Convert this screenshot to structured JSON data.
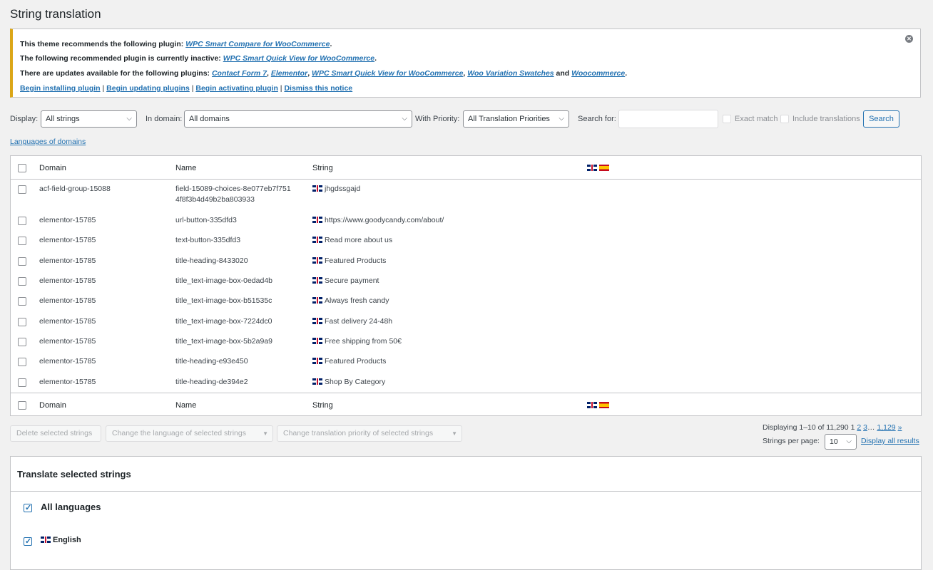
{
  "page": {
    "title": "String translation"
  },
  "notice": {
    "line1_prefix": "This theme recommends the following plugin: ",
    "line1_link": "WPC Smart Compare for WooCommerce",
    "line2_prefix": "The following recommended plugin is currently inactive: ",
    "line2_link": "WPC Smart Quick View for WooCommerce",
    "line3_prefix": "There are updates available for the following plugins: ",
    "line3_links": [
      "Contact Form 7",
      "Elementor",
      "WPC Smart Quick View for WooCommerce",
      "Woo Variation Swatches",
      "Woocommerce"
    ],
    "line3_and": " and ",
    "actions": [
      "Begin installing plugin",
      "Begin updating plugins",
      "Begin activating plugin",
      "Dismiss this notice"
    ],
    "separator": " | "
  },
  "filters": {
    "display_label": "Display:",
    "display_value": "All strings",
    "domain_label": "In domain:",
    "domain_value": "All domains",
    "priority_label": "With Priority:",
    "priority_value": "All Translation Priorities",
    "search_label": "Search for:",
    "search_value": "",
    "exact_match_label": "Exact match",
    "include_translations_label": "Include translations",
    "search_button": "Search"
  },
  "languages_of_domains_link": "Languages of domains",
  "table": {
    "headers": {
      "domain": "Domain",
      "name": "Name",
      "string": "String"
    },
    "rows": [
      {
        "domain": "acf-field-group-15088",
        "name": "field-15089-choices-8e077eb7f751",
        "name2": "4f8f3b4d49b2ba803933",
        "string": "jhgdssgajd"
      },
      {
        "domain": "elementor-15785",
        "name": "url-button-335dfd3",
        "string": "https://www.goodycandy.com/about/"
      },
      {
        "domain": "elementor-15785",
        "name": "text-button-335dfd3",
        "string": "Read more about us"
      },
      {
        "domain": "elementor-15785",
        "name": "title-heading-8433020",
        "string": "Featured Products"
      },
      {
        "domain": "elementor-15785",
        "name": "title_text-image-box-0edad4b",
        "string": "Secure payment"
      },
      {
        "domain": "elementor-15785",
        "name": "title_text-image-box-b51535c",
        "string": "Always fresh candy"
      },
      {
        "domain": "elementor-15785",
        "name": "title_text-image-box-7224dc0",
        "string": "Fast delivery 24-48h"
      },
      {
        "domain": "elementor-15785",
        "name": "title_text-image-box-5b2a9a9",
        "string": "Free shipping from 50€"
      },
      {
        "domain": "elementor-15785",
        "name": "title-heading-e93e450",
        "string": "Featured Products"
      },
      {
        "domain": "elementor-15785",
        "name": "title-heading-de394e2",
        "string": "Shop By Category"
      }
    ]
  },
  "bulk": {
    "delete": "Delete selected strings",
    "change_language": "Change the language of selected strings",
    "change_priority": "Change translation priority of selected strings"
  },
  "pagination": {
    "displaying": "Displaying 1–10 of 11,290",
    "current": "1",
    "pages": [
      "2",
      "3"
    ],
    "ellipsis": "…",
    "last": "1,129",
    "next": "»",
    "per_page_label": "Strings per page:",
    "per_page_value": "10",
    "display_all": "Display all results"
  },
  "translate_panel": {
    "title": "Translate selected strings",
    "all_languages": "All languages",
    "english": "English"
  },
  "flags": {
    "uk": "uk-flag-icon",
    "es": "es-flag-icon"
  },
  "colors": {
    "link": "#2271b1",
    "notice_border": "#dba617"
  }
}
